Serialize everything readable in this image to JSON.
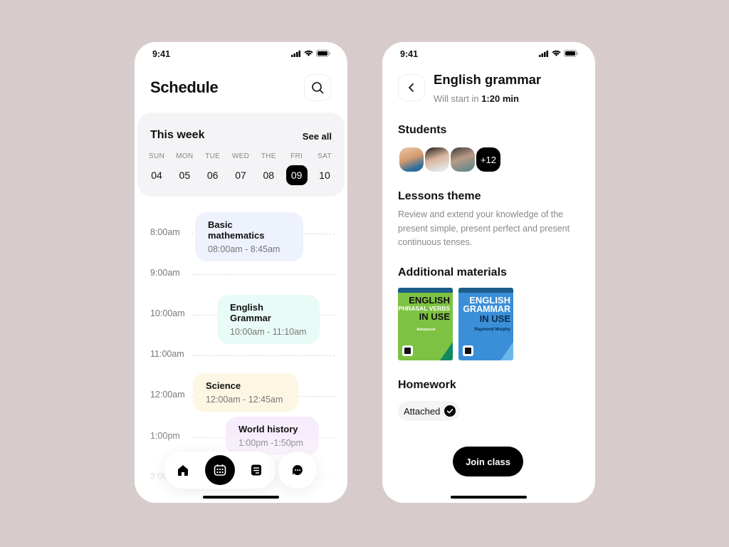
{
  "left": {
    "status_time": "9:41",
    "title": "Schedule",
    "week": {
      "title": "This week",
      "see_all": "See all",
      "days": [
        {
          "name": "SUN",
          "num": "04"
        },
        {
          "name": "MON",
          "num": "05"
        },
        {
          "name": "TUE",
          "num": "06"
        },
        {
          "name": "WED",
          "num": "07"
        },
        {
          "name": "THE",
          "num": "08"
        },
        {
          "name": "FRI",
          "num": "09",
          "active": true
        },
        {
          "name": "SAT",
          "num": "10"
        }
      ]
    },
    "times": [
      "8:00am",
      "9:00am",
      "10:00am",
      "11:00am",
      "12:00am",
      "1:00pm",
      "2:00pm"
    ],
    "events": [
      {
        "name": "Basic mathematics",
        "time": "08:00am - 8:45am",
        "color": "#eef2fd"
      },
      {
        "name": "English Grammar",
        "time": "10:00am - 11:10am",
        "color": "#e9fbf7"
      },
      {
        "name": "Science",
        "time": "12:00am - 12:45am",
        "color": "#fdf6e3"
      },
      {
        "name": "World history",
        "time": "1:00pm -1:50pm",
        "color": "#f6ecfb"
      }
    ],
    "nav": [
      "home-icon",
      "calendar-icon",
      "notes-icon",
      "chat-icon"
    ]
  },
  "right": {
    "status_time": "9:41",
    "title": "English grammar",
    "subtitle_prefix": "Will start in",
    "subtitle_time": "1:20 min",
    "students_label": "Students",
    "students_more": "+12",
    "theme_label": "Lessons theme",
    "theme_text": "Review and extend your knowledge of the present simple, present perfect and present continuous tenses.",
    "materials_label": "Additional materials",
    "books": [
      {
        "line1": "ENGLISH",
        "line2": "PHRASAL VERBS",
        "line3": "IN USE",
        "sub": "Advanced",
        "color": "#7dc242"
      },
      {
        "line1": "ENGLISH",
        "line2": "GRAMMAR",
        "line3": "IN USE",
        "sub": "Raymond Murphy",
        "color": "#3a8fd8"
      }
    ],
    "homework_label": "Homework",
    "homework_status": "Attached",
    "join_label": "Join class"
  }
}
